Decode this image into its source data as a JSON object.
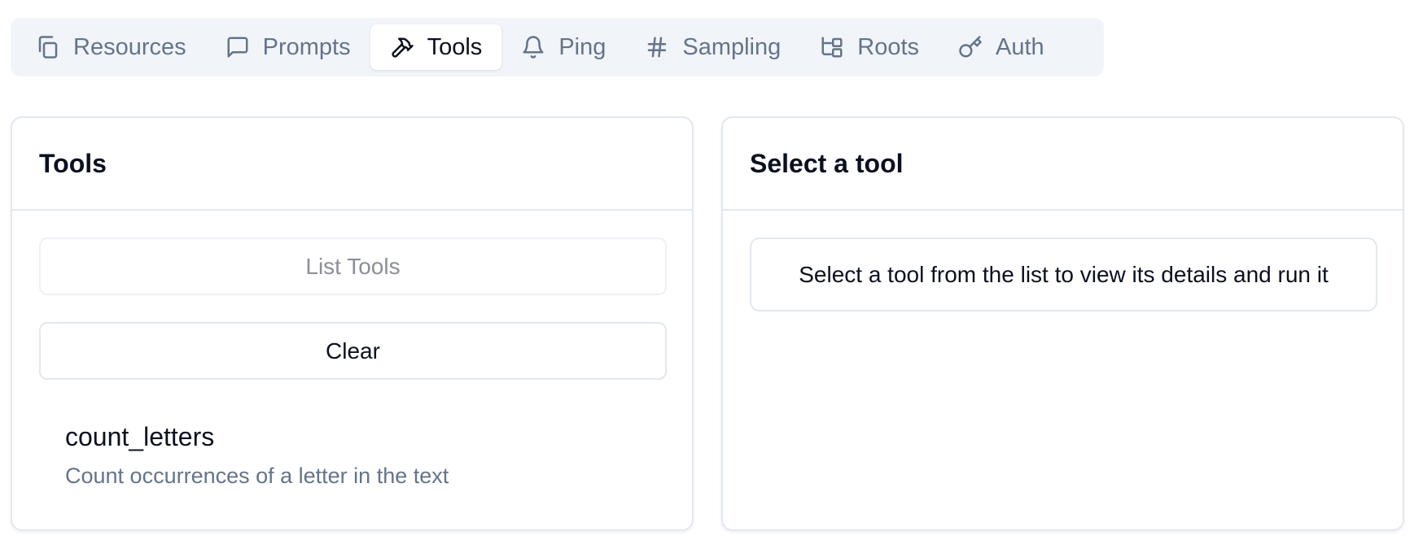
{
  "tabs": [
    {
      "label": "Resources",
      "icon": "files-icon",
      "active": false
    },
    {
      "label": "Prompts",
      "icon": "message-square-icon",
      "active": false
    },
    {
      "label": "Tools",
      "icon": "hammer-icon",
      "active": true
    },
    {
      "label": "Ping",
      "icon": "bell-icon",
      "active": false
    },
    {
      "label": "Sampling",
      "icon": "hash-icon",
      "active": false
    },
    {
      "label": "Roots",
      "icon": "folder-tree-icon",
      "active": false
    },
    {
      "label": "Auth",
      "icon": "key-icon",
      "active": false
    }
  ],
  "tools_panel": {
    "title": "Tools",
    "list_button": "List Tools",
    "clear_button": "Clear",
    "items": [
      {
        "name": "count_letters",
        "description": "Count occurrences of a letter in the text"
      }
    ]
  },
  "detail_panel": {
    "title": "Select a tool",
    "placeholder": "Select a tool from the list to view its details and run it"
  }
}
